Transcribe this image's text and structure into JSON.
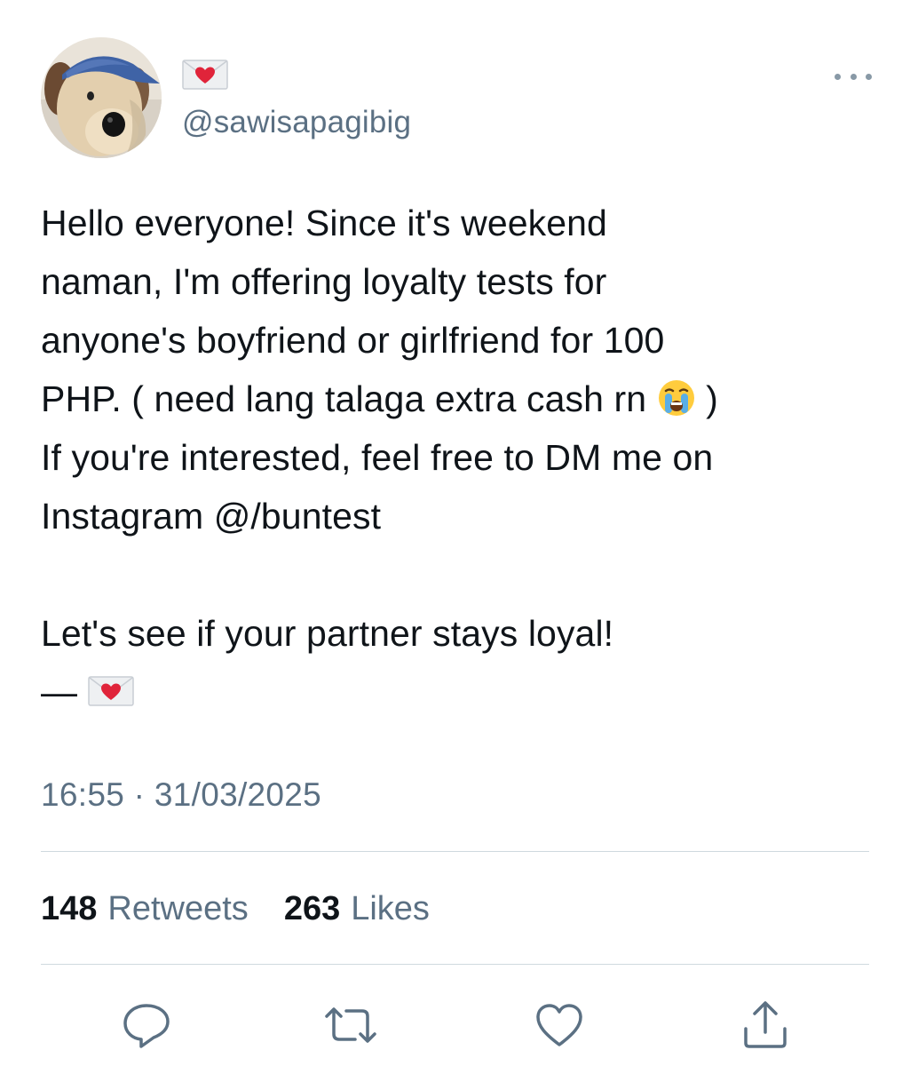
{
  "tweet": {
    "display_name_icon": "love-letter-emoji",
    "handle": "@sawisapagibig",
    "text_lines": [
      "Hello everyone! Since it's weekend",
      "naman, I'm offering loyalty tests for",
      "anyone's boyfriend or girlfriend for 100",
      "PHP. ( need lang talaga extra cash rn",
      ")",
      "If you're interested, feel free to DM me on",
      "Instagram @/buntest",
      "",
      "Let's see if your partner stays loyal!",
      "—"
    ],
    "inline_emojis": [
      "loudly-crying-face-emoji",
      "love-letter-emoji"
    ],
    "timestamp": "16:55 · 31/03/2025",
    "retweets": {
      "count": "148",
      "label": "Retweets"
    },
    "likes": {
      "count": "263",
      "label": "Likes"
    }
  },
  "actions": {
    "icons": [
      "reply-icon",
      "retweet-icon",
      "like-icon",
      "share-icon"
    ]
  },
  "colors": {
    "text": "#0f1419",
    "secondary": "#5b7083",
    "divider": "#cfd9de",
    "icon": "#5b7083"
  }
}
